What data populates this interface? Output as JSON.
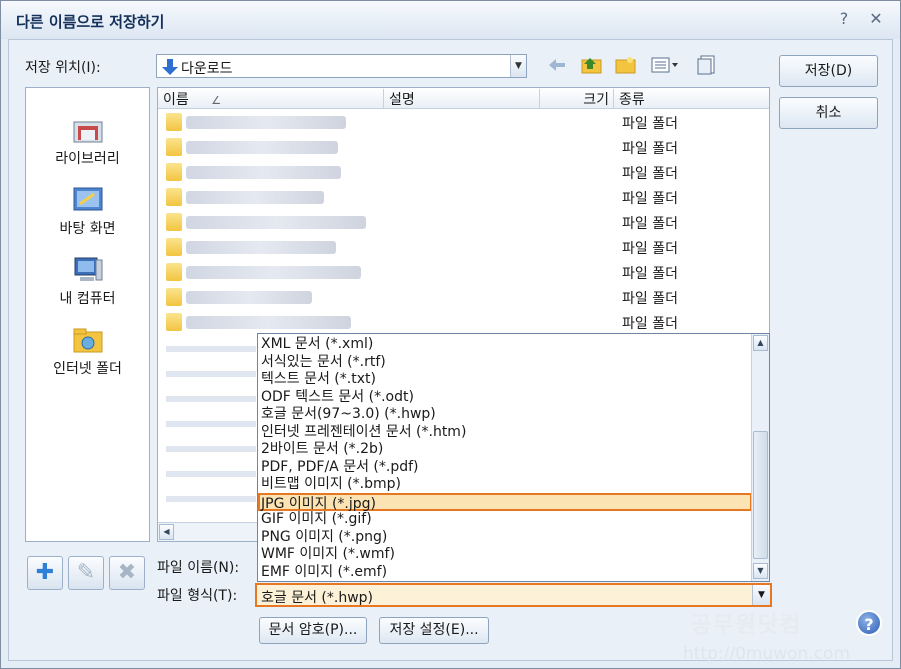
{
  "window": {
    "title": "다른 이름으로 저장하기",
    "help_glyph": "?",
    "close_glyph": "✕"
  },
  "location": {
    "label": "저장 위치(I):",
    "value": "다운로드"
  },
  "buttons": {
    "save": "저장(D)",
    "cancel": "취소",
    "doc_password": "문서 암호(P)...",
    "save_settings": "저장 설정(E)..."
  },
  "places": [
    {
      "label": "라이브러리",
      "icon": "library-icon"
    },
    {
      "label": "바탕 화면",
      "icon": "desktop-icon"
    },
    {
      "label": "내 컴퓨터",
      "icon": "computer-icon"
    },
    {
      "label": "인터넷 폴더",
      "icon": "internet-folder-icon"
    }
  ],
  "columns": {
    "name": "이름",
    "description": "설명",
    "size": "크기",
    "type": "종류"
  },
  "files": [
    {
      "type": "파일 폴더"
    },
    {
      "type": "파일 폴더"
    },
    {
      "type": "파일 폴더"
    },
    {
      "type": "파일 폴더"
    },
    {
      "type": "파일 폴더"
    },
    {
      "type": "파일 폴더"
    },
    {
      "type": "파일 폴더"
    },
    {
      "type": "파일 폴더"
    },
    {
      "type": "파일 폴더"
    }
  ],
  "filename_label": "파일 이름(N):",
  "filetype_label": "파일 형식(T):",
  "filetype_value": "호글 문서 (*.hwp)",
  "filetype_options": [
    "XML 문서 (*.xml)",
    "서식있는 문서 (*.rtf)",
    "텍스트 문서 (*.txt)",
    "ODF 텍스트 문서 (*.odt)",
    "호글 문서(97~3.0) (*.hwp)",
    "인터넷 프레젠테이션 문서 (*.htm)",
    "2바이트 문서 (*.2b)",
    "PDF, PDF/A 문서 (*.pdf)",
    "비트맵 이미지 (*.bmp)",
    "JPG 이미지 (*.jpg)",
    "GIF 이미지 (*.gif)",
    "PNG 이미지 (*.png)",
    "WMF 이미지 (*.wmf)",
    "EMF 이미지 (*.emf)"
  ],
  "selected_option": "JPG 이미지 (*.jpg)",
  "watermark": {
    "title": "공무원닷컴",
    "url": "http://0muwon.com"
  },
  "colors": {
    "highlight": "#e87722",
    "title_text": "#14305a"
  }
}
